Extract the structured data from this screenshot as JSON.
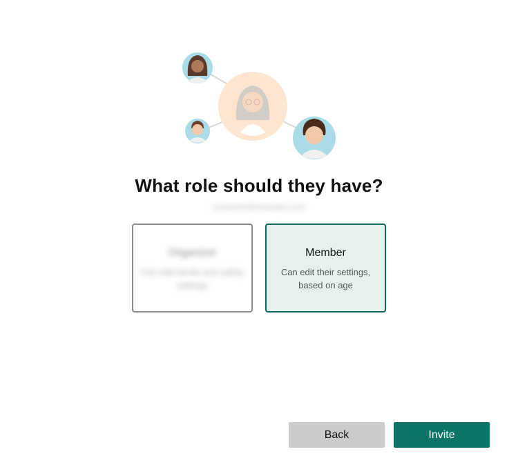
{
  "dialog": {
    "heading": "What role should they have?",
    "subtext": "someone@example.com",
    "illustration": {
      "icon": "family-people-illustration",
      "colors": {
        "center_circle": "#fde5cf",
        "side_circles": "#a9dce6"
      }
    },
    "roles": [
      {
        "title": "Organizer",
        "description": "Can edit family and safety settings",
        "selected": false,
        "blurred": true
      },
      {
        "title": "Member",
        "description": "Can edit their settings, based on age",
        "selected": true,
        "blurred": false
      }
    ],
    "buttons": {
      "back_label": "Back",
      "invite_label": "Invite"
    },
    "colors": {
      "accent": "#0b7466",
      "selected_card_bg": "#e6f0ee",
      "back_button_bg": "#cccccc"
    }
  }
}
